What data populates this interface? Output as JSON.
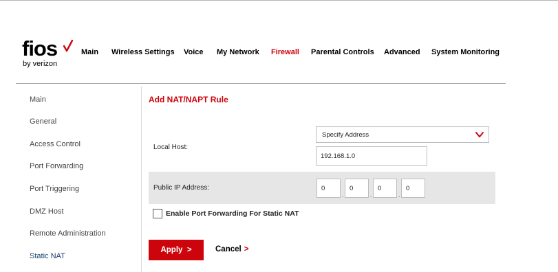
{
  "brand": {
    "logo_text": "fios",
    "logo_sub": "by verizon",
    "accent_color": "#cd040b"
  },
  "nav": {
    "items": [
      {
        "label": "Main"
      },
      {
        "label": "Wireless Settings"
      },
      {
        "label": "Voice"
      },
      {
        "label": "My Network"
      },
      {
        "label": "Firewall",
        "active": true
      },
      {
        "label": "Parental Controls"
      },
      {
        "label": "Advanced"
      },
      {
        "label": "System Monitoring"
      }
    ]
  },
  "sidebar": {
    "items": [
      {
        "label": "Main"
      },
      {
        "label": "General"
      },
      {
        "label": "Access Control"
      },
      {
        "label": "Port Forwarding"
      },
      {
        "label": "Port Triggering"
      },
      {
        "label": "DMZ Host"
      },
      {
        "label": "Remote Administration"
      },
      {
        "label": "Static NAT",
        "active": true
      }
    ]
  },
  "form": {
    "title": "Add NAT/NAPT Rule",
    "local_host": {
      "label": "Local Host:",
      "select_value": "Specify Address",
      "ip_value": "192.168.1.0"
    },
    "public_ip": {
      "label": "Public IP Address:",
      "octets": [
        "0",
        "0",
        "0",
        "0"
      ]
    },
    "port_forwarding_checkbox": {
      "label": "Enable Port Forwarding For Static NAT",
      "checked": false
    },
    "apply_label": "Apply",
    "apply_chevron": ">",
    "cancel_label": "Cancel",
    "cancel_chevron": ">"
  }
}
